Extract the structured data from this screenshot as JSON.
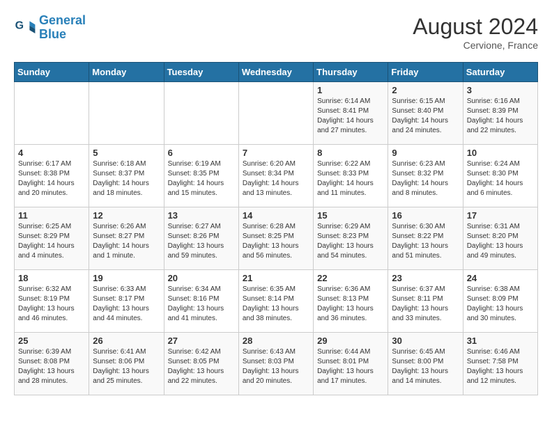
{
  "logo": {
    "line1": "General",
    "line2": "Blue"
  },
  "title": "August 2024",
  "location": "Cervione, France",
  "header_days": [
    "Sunday",
    "Monday",
    "Tuesday",
    "Wednesday",
    "Thursday",
    "Friday",
    "Saturday"
  ],
  "weeks": [
    [
      {
        "day": "",
        "info": ""
      },
      {
        "day": "",
        "info": ""
      },
      {
        "day": "",
        "info": ""
      },
      {
        "day": "",
        "info": ""
      },
      {
        "day": "1",
        "info": "Sunrise: 6:14 AM\nSunset: 8:41 PM\nDaylight: 14 hours\nand 27 minutes."
      },
      {
        "day": "2",
        "info": "Sunrise: 6:15 AM\nSunset: 8:40 PM\nDaylight: 14 hours\nand 24 minutes."
      },
      {
        "day": "3",
        "info": "Sunrise: 6:16 AM\nSunset: 8:39 PM\nDaylight: 14 hours\nand 22 minutes."
      }
    ],
    [
      {
        "day": "4",
        "info": "Sunrise: 6:17 AM\nSunset: 8:38 PM\nDaylight: 14 hours\nand 20 minutes."
      },
      {
        "day": "5",
        "info": "Sunrise: 6:18 AM\nSunset: 8:37 PM\nDaylight: 14 hours\nand 18 minutes."
      },
      {
        "day": "6",
        "info": "Sunrise: 6:19 AM\nSunset: 8:35 PM\nDaylight: 14 hours\nand 15 minutes."
      },
      {
        "day": "7",
        "info": "Sunrise: 6:20 AM\nSunset: 8:34 PM\nDaylight: 14 hours\nand 13 minutes."
      },
      {
        "day": "8",
        "info": "Sunrise: 6:22 AM\nSunset: 8:33 PM\nDaylight: 14 hours\nand 11 minutes."
      },
      {
        "day": "9",
        "info": "Sunrise: 6:23 AM\nSunset: 8:32 PM\nDaylight: 14 hours\nand 8 minutes."
      },
      {
        "day": "10",
        "info": "Sunrise: 6:24 AM\nSunset: 8:30 PM\nDaylight: 14 hours\nand 6 minutes."
      }
    ],
    [
      {
        "day": "11",
        "info": "Sunrise: 6:25 AM\nSunset: 8:29 PM\nDaylight: 14 hours\nand 4 minutes."
      },
      {
        "day": "12",
        "info": "Sunrise: 6:26 AM\nSunset: 8:27 PM\nDaylight: 14 hours\nand 1 minute."
      },
      {
        "day": "13",
        "info": "Sunrise: 6:27 AM\nSunset: 8:26 PM\nDaylight: 13 hours\nand 59 minutes."
      },
      {
        "day": "14",
        "info": "Sunrise: 6:28 AM\nSunset: 8:25 PM\nDaylight: 13 hours\nand 56 minutes."
      },
      {
        "day": "15",
        "info": "Sunrise: 6:29 AM\nSunset: 8:23 PM\nDaylight: 13 hours\nand 54 minutes."
      },
      {
        "day": "16",
        "info": "Sunrise: 6:30 AM\nSunset: 8:22 PM\nDaylight: 13 hours\nand 51 minutes."
      },
      {
        "day": "17",
        "info": "Sunrise: 6:31 AM\nSunset: 8:20 PM\nDaylight: 13 hours\nand 49 minutes."
      }
    ],
    [
      {
        "day": "18",
        "info": "Sunrise: 6:32 AM\nSunset: 8:19 PM\nDaylight: 13 hours\nand 46 minutes."
      },
      {
        "day": "19",
        "info": "Sunrise: 6:33 AM\nSunset: 8:17 PM\nDaylight: 13 hours\nand 44 minutes."
      },
      {
        "day": "20",
        "info": "Sunrise: 6:34 AM\nSunset: 8:16 PM\nDaylight: 13 hours\nand 41 minutes."
      },
      {
        "day": "21",
        "info": "Sunrise: 6:35 AM\nSunset: 8:14 PM\nDaylight: 13 hours\nand 38 minutes."
      },
      {
        "day": "22",
        "info": "Sunrise: 6:36 AM\nSunset: 8:13 PM\nDaylight: 13 hours\nand 36 minutes."
      },
      {
        "day": "23",
        "info": "Sunrise: 6:37 AM\nSunset: 8:11 PM\nDaylight: 13 hours\nand 33 minutes."
      },
      {
        "day": "24",
        "info": "Sunrise: 6:38 AM\nSunset: 8:09 PM\nDaylight: 13 hours\nand 30 minutes."
      }
    ],
    [
      {
        "day": "25",
        "info": "Sunrise: 6:39 AM\nSunset: 8:08 PM\nDaylight: 13 hours\nand 28 minutes."
      },
      {
        "day": "26",
        "info": "Sunrise: 6:41 AM\nSunset: 8:06 PM\nDaylight: 13 hours\nand 25 minutes."
      },
      {
        "day": "27",
        "info": "Sunrise: 6:42 AM\nSunset: 8:05 PM\nDaylight: 13 hours\nand 22 minutes."
      },
      {
        "day": "28",
        "info": "Sunrise: 6:43 AM\nSunset: 8:03 PM\nDaylight: 13 hours\nand 20 minutes."
      },
      {
        "day": "29",
        "info": "Sunrise: 6:44 AM\nSunset: 8:01 PM\nDaylight: 13 hours\nand 17 minutes."
      },
      {
        "day": "30",
        "info": "Sunrise: 6:45 AM\nSunset: 8:00 PM\nDaylight: 13 hours\nand 14 minutes."
      },
      {
        "day": "31",
        "info": "Sunrise: 6:46 AM\nSunset: 7:58 PM\nDaylight: 13 hours\nand 12 minutes."
      }
    ]
  ]
}
